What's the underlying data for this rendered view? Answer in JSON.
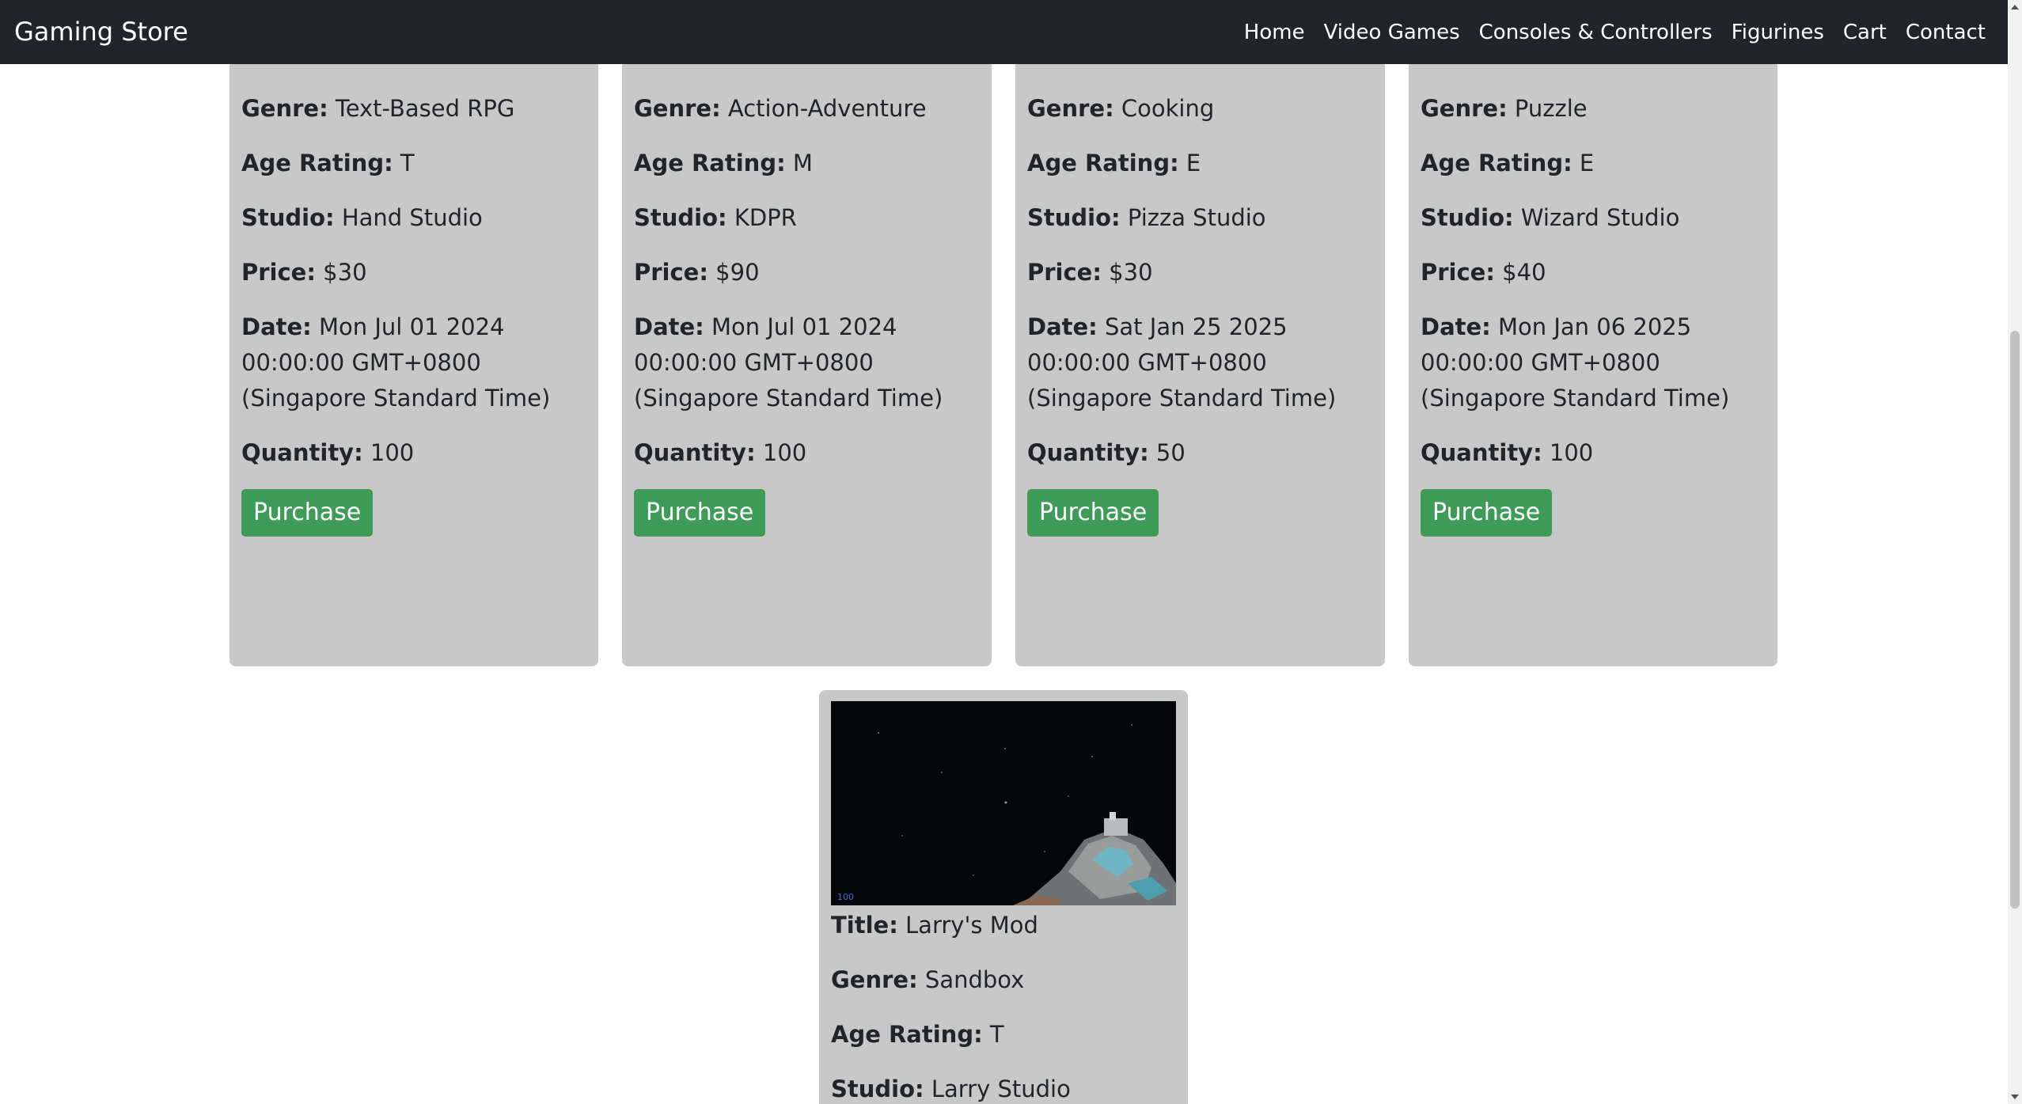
{
  "navbar": {
    "brand": "Gaming Store",
    "links": [
      "Home",
      "Video Games",
      "Consoles & Controllers",
      "Figurines",
      "Cart",
      "Contact"
    ]
  },
  "labels": {
    "title": "Title:",
    "genre": "Genre:",
    "age": "Age Rating:",
    "studio": "Studio:",
    "price": "Price:",
    "date": "Date:",
    "quantity": "Quantity:"
  },
  "games": [
    {
      "genre": "Text-Based RPG",
      "age_rating": "T",
      "studio": "Hand Studio",
      "price": "$30",
      "date": "Mon Jul 01 2024 00:00:00 GMT+0800 (Singapore Standard Time)",
      "quantity": "100",
      "button": "Purchase"
    },
    {
      "genre": "Action-Adventure",
      "age_rating": "M",
      "studio": "KDPR",
      "price": "$90",
      "date": "Mon Jul 01 2024 00:00:00 GMT+0800 (Singapore Standard Time)",
      "quantity": "100",
      "button": "Purchase"
    },
    {
      "genre": "Cooking",
      "age_rating": "E",
      "studio": "Pizza Studio",
      "price": "$30",
      "date": "Sat Jan 25 2025 00:00:00 GMT+0800 (Singapore Standard Time)",
      "quantity": "50",
      "button": "Purchase"
    },
    {
      "genre": "Puzzle",
      "age_rating": "E",
      "studio": "Wizard Studio",
      "price": "$40",
      "date": "Mon Jan 06 2025 00:00:00 GMT+0800 (Singapore Standard Time)",
      "quantity": "100",
      "button": "Purchase"
    },
    {
      "title": "Larry's Mod",
      "genre": "Sandbox",
      "age_rating": "T",
      "studio": "Larry Studio"
    }
  ],
  "colors": {
    "navbar": "#212529",
    "card": "#c8c8c8",
    "button": "#3e9b58"
  }
}
